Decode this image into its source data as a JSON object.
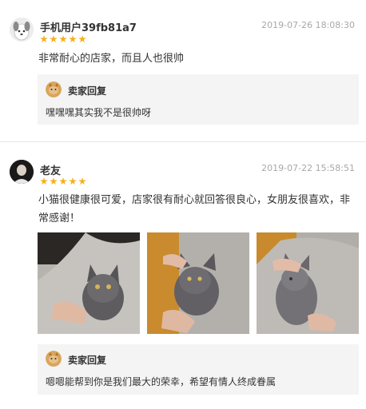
{
  "reviews": [
    {
      "username": "手机用户39fb81a7",
      "timestamp": "2019-07-26 18:08:30",
      "rating": 5,
      "text": "非常耐心的店家，而且人也很帅",
      "seller_reply": {
        "title": "卖家回复",
        "text": "嘿嘿嘿其实我不是很帅呀"
      }
    },
    {
      "username": "老友",
      "timestamp": "2019-07-22 15:58:51",
      "rating": 5,
      "text_line1": "小猫很健康很可爱，店家很有耐心就回答很良心，女朋友很喜欢，非",
      "text_line2": "常感谢！",
      "photos": [
        "cat-photo-1",
        "cat-photo-2",
        "cat-photo-3"
      ],
      "seller_reply": {
        "title": "卖家回复",
        "text": "嗯嗯能帮到你是我们最大的荣幸，希望有情人终成眷属"
      }
    }
  ],
  "colors": {
    "star": "#f5b01a",
    "timestamp": "#a8a8a8",
    "reply_bg": "#f4f4f4"
  }
}
